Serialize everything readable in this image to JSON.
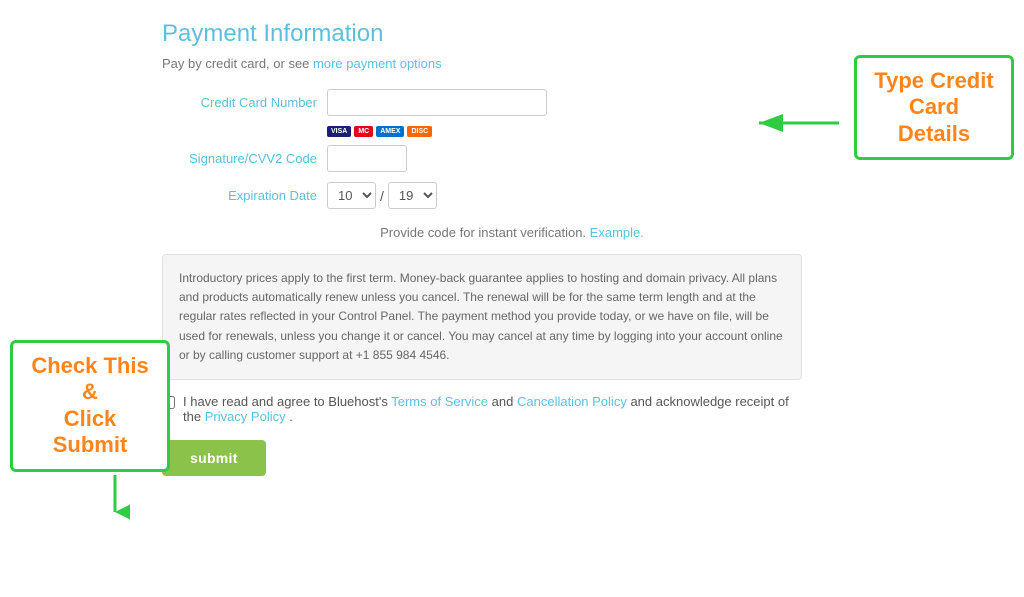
{
  "page": {
    "title": "Payment Information",
    "subtitle_text": "Pay by credit card, or see ",
    "subtitle_link": "more payment options",
    "verification_text": "Provide code for instant verification. ",
    "verification_link": "Example.",
    "form": {
      "cc_number_label": "Credit Card Number",
      "cc_number_placeholder": "",
      "cvv_label": "Signature/CVV2 Code",
      "cvv_placeholder": "",
      "expiry_label": "Expiration Date",
      "expiry_month": "10",
      "expiry_year": "19"
    },
    "info_box_text": "Introductory prices apply to the first term. Money-back guarantee applies to hosting and domain privacy. All plans and products automatically renew unless you cancel. The renewal will be for the same term length and at the regular rates reflected in your Control Panel. The payment method you provide today, or we have on file, will be used for renewals, unless you change it or cancel. You may cancel at any time by logging into your account online or by calling customer support at +1 855 984 4546.",
    "agree_text_1": "I have read and agree to Bluehost's ",
    "agree_link_tos": "Terms of Service",
    "agree_text_2": " and ",
    "agree_link_cancel": "Cancellation Policy",
    "agree_text_3": " and acknowledge receipt of the ",
    "agree_link_privacy": "Privacy Policy",
    "agree_text_4": ".",
    "submit_label": "submit"
  },
  "annotations": {
    "type_cc": "Type Credit\nCard Details",
    "check_submit": "Check This &\nClick Submit"
  }
}
